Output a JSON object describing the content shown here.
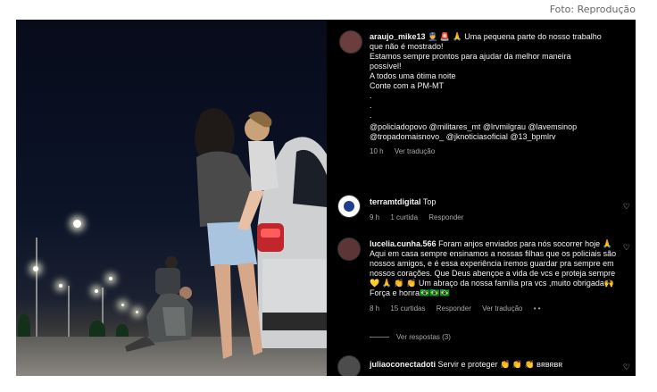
{
  "credit": "Foto: Reprodução",
  "post": {
    "username": "araujo_mike13",
    "emoji": "👮 🚨 🙏",
    "lines": [
      "Uma pequena parte do nosso trabalho",
      "que não é mostrado!",
      "Estamos sempre prontos para ajudar da melhor maneira",
      "possível!",
      "A todos uma ótima noite",
      "Conte com a PM-MT",
      ".",
      ".",
      "."
    ],
    "mentions_1": "@policiadopovo @militares_mt @lrvmilgrau @lavemsinop",
    "mentions_2": "@tropadomaisnovo_ @jknoticiasoficial @13_bpmlrv",
    "time": "10 h",
    "translate": "Ver tradução"
  },
  "comments": [
    {
      "username": "terramtdigital",
      "text": "Top",
      "time": "9 h",
      "likes": "1 curtida",
      "reply": "Responder"
    },
    {
      "username": "lucelia.cunha.566",
      "text": "Foram anjos enviados para nós socorrer hoje 🙏 Aqui em casa sempre ensinamos a nossas filhas que os policiais são nossos amigos, e é essa experiência iremos guardar pra sempre em nossos corações. Que Deus abençoe a vida de vcs e proteja sempre💛 🙏 👏 👏 Um abraço da nossa família pra vcs ,muito obrigada🙌 Força e honra🇧🇷🇧🇷🇧🇷",
      "time": "8 h",
      "likes": "15 curtidas",
      "reply": "Responder",
      "translate": "Ver tradução",
      "more": "• •",
      "view_replies": "Ver respostas (3)"
    },
    {
      "username": "juliaoconectadoti",
      "text": "Servir e proteger 👏 👏 👏 ʙʀʙʀʙʀ"
    }
  ],
  "icons": {
    "heart": "heart-icon",
    "verified_avatar": "avatar"
  }
}
